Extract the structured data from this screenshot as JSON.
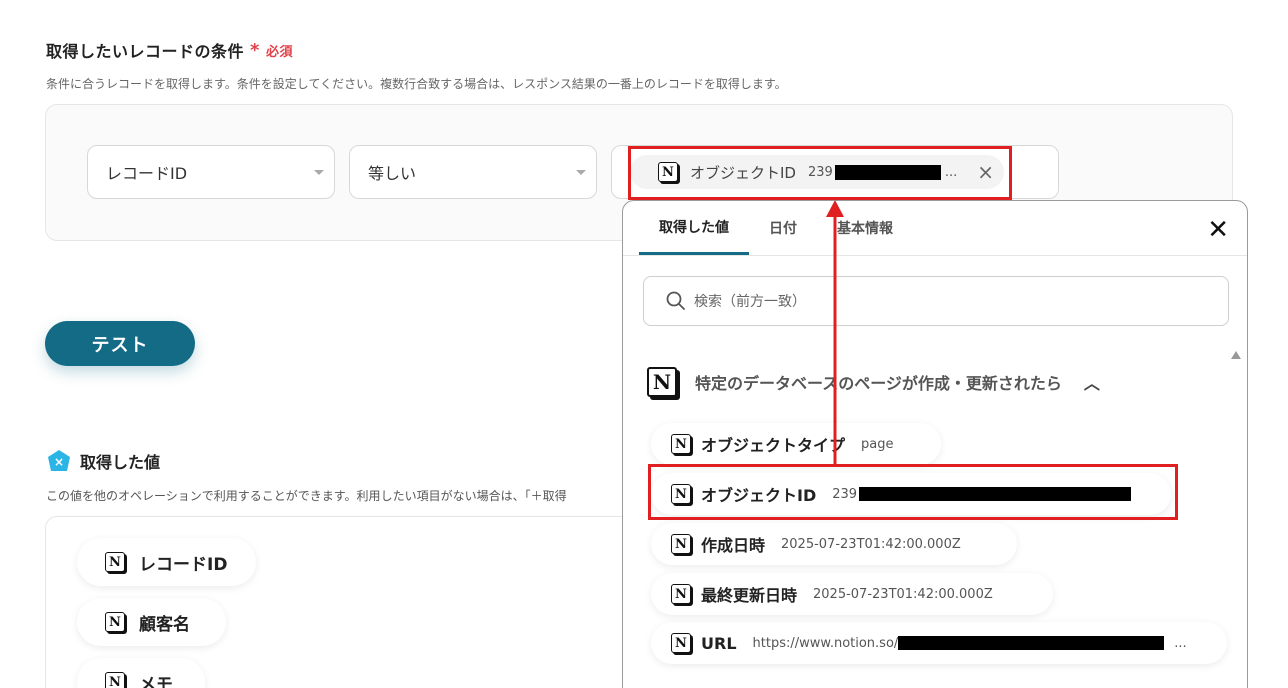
{
  "section": {
    "title": "取得したいレコードの条件",
    "required_star": "*",
    "required_label": "必須",
    "description": "条件に合うレコードを取得します。条件を設定してください。複数行合致する場合は、レスポンス結果の一番上のレコードを取得します。"
  },
  "condition": {
    "field_select": "レコードID",
    "operator_select": "等しい",
    "value_chip_label": "オブジェクトID",
    "value_chip_id_prefix": "239",
    "value_chip_ellipsis": "...",
    "clear_icon": "×"
  },
  "test_button": "テスト",
  "acquired": {
    "title": "取得した値",
    "description": "この値を他のオペレーションで利用することができます。利用したい項目がない場合は、「＋取得",
    "items": [
      "レコードID",
      "顧客名",
      "メモ"
    ]
  },
  "popup": {
    "tabs": [
      "取得した値",
      "日付",
      "基本情報"
    ],
    "active_tab": 0,
    "close_icon": "✕",
    "search_placeholder": "検索（前方一致）",
    "group_title": "特定のデータベースのページが作成・更新されたら",
    "group_chevron": "︿",
    "items": [
      {
        "label": "オブジェクトタイプ",
        "value": "page"
      },
      {
        "label": "オブジェクトID",
        "value": "239"
      },
      {
        "label": "作成日時",
        "value": "2025-07-23T01:42:00.000Z"
      },
      {
        "label": "最終更新日時",
        "value": "2025-07-23T01:42:00.000Z"
      },
      {
        "label": "URL",
        "value": "https://www.notion.so/",
        "suffix": "..."
      }
    ]
  },
  "colors": {
    "accent": "#146b86",
    "highlight": "#e02020",
    "required": "#e0434b"
  },
  "icons": {
    "notion": "N"
  }
}
